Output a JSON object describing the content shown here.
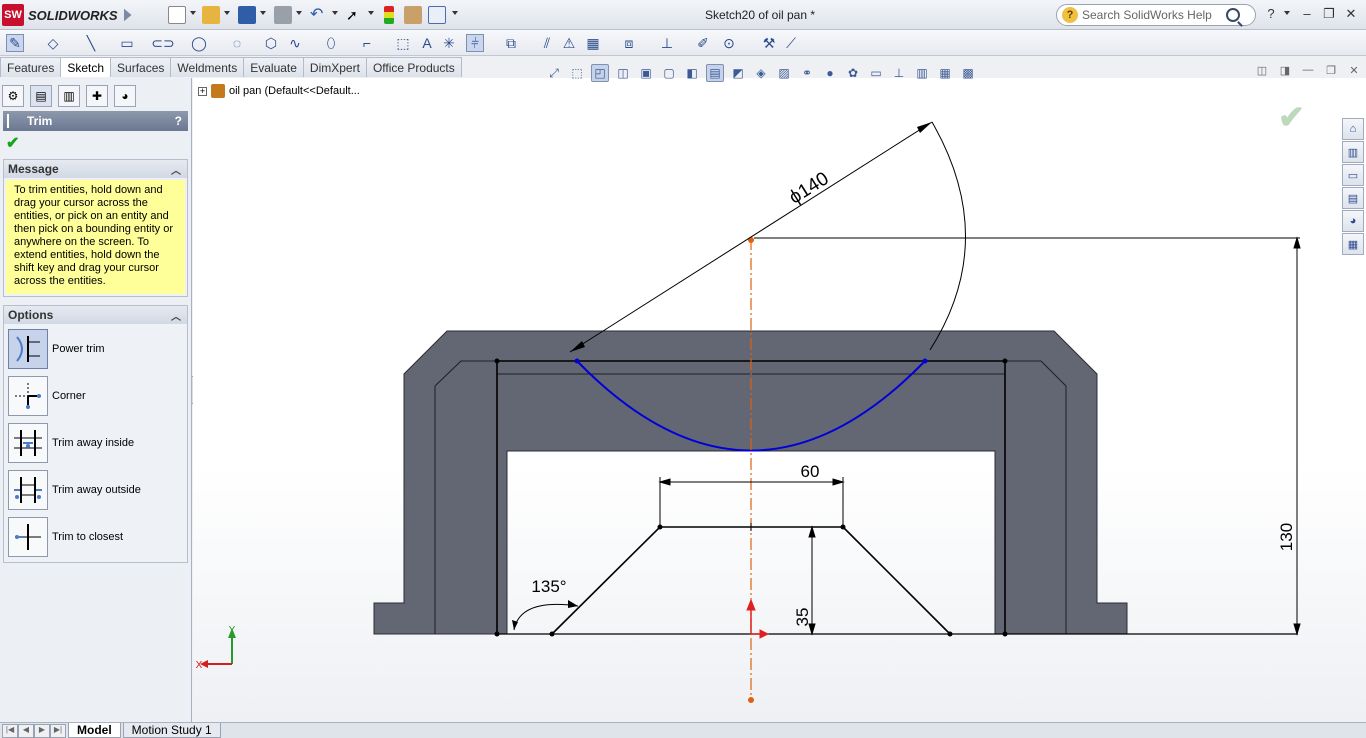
{
  "titlebar": {
    "app_name": "SOLIDWORKS",
    "logo_mark": "SW",
    "doc_title": "Sketch20 of oil pan *",
    "search_placeholder": "Search SolidWorks Help"
  },
  "tabs": [
    {
      "label": "Features",
      "active": false
    },
    {
      "label": "Sketch",
      "active": true
    },
    {
      "label": "Surfaces",
      "active": false
    },
    {
      "label": "Weldments",
      "active": false
    },
    {
      "label": "Evaluate",
      "active": false
    },
    {
      "label": "DimXpert",
      "active": false
    },
    {
      "label": "Office Products",
      "active": false
    }
  ],
  "tree": {
    "node_label": "oil pan  (Default<<Default..."
  },
  "property_manager": {
    "title": "Trim",
    "help_label": "?",
    "message_header": "Message",
    "message_text": "To trim entities, hold down and drag your cursor across the entities, or pick on an entity and then pick on a bounding entity or anywhere on the screen.  To extend entities, hold down the shift key and drag your cursor across the entities.",
    "options_header": "Options",
    "options": [
      {
        "label": "Power trim",
        "icon": "power-trim-icon",
        "active": true
      },
      {
        "label": "Corner",
        "icon": "corner-trim-icon",
        "active": false
      },
      {
        "label": "Trim away inside",
        "icon": "trim-inside-icon",
        "active": false
      },
      {
        "label": "Trim away outside",
        "icon": "trim-outside-icon",
        "active": false
      },
      {
        "label": "Trim to closest",
        "icon": "trim-closest-icon",
        "active": false
      }
    ]
  },
  "sketch": {
    "dim_diameter": "ϕ140",
    "dim_width": "60",
    "dim_height": "35",
    "dim_total_height": "130",
    "dim_angle": "135°"
  },
  "triad": {
    "x_label": "X",
    "y_label": "Y"
  },
  "bottom_tabs": [
    {
      "label": "Model",
      "active": true
    },
    {
      "label": "Motion Study 1",
      "active": false
    }
  ],
  "colors": {
    "part_fill": "#636774",
    "arc_blue": "#0000d8",
    "centerline_orange": "#e06010",
    "accent_red": "#c8102e"
  }
}
